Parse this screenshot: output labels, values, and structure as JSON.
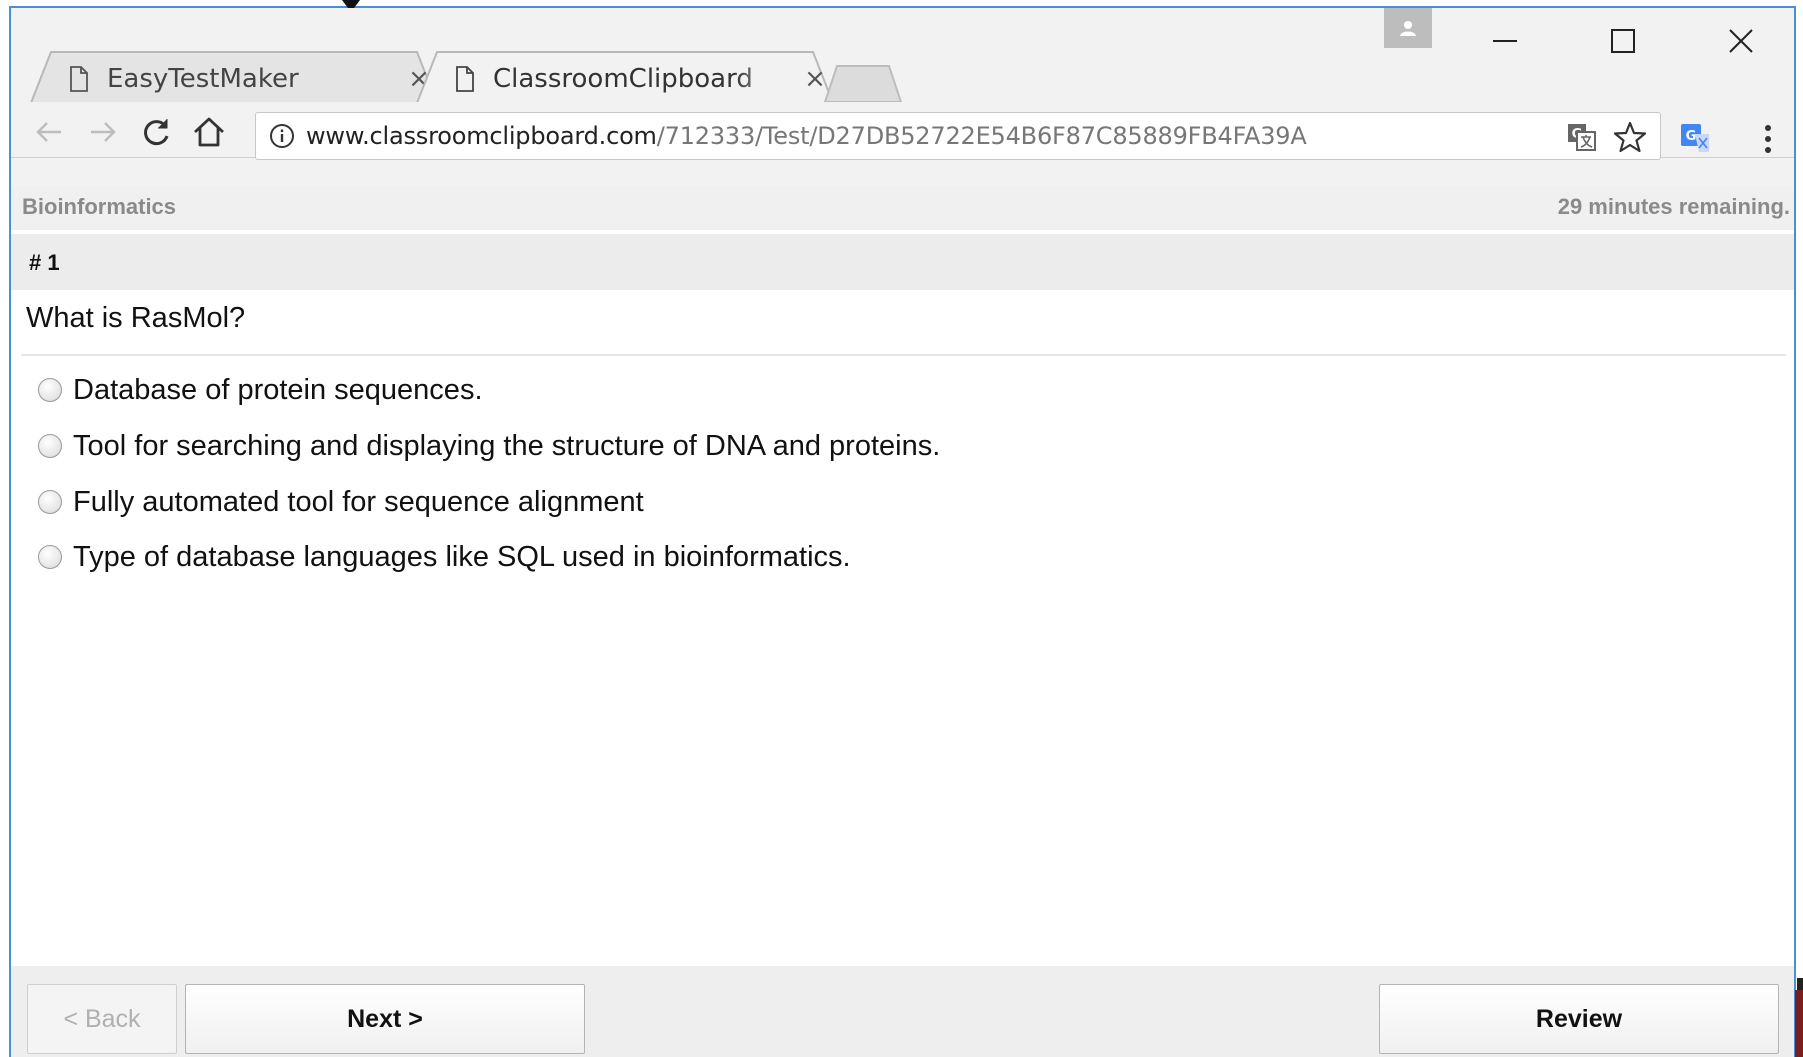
{
  "browser": {
    "tabs": [
      {
        "title": "EasyTestMaker",
        "close": "×",
        "active": false
      },
      {
        "title": "ClassroomClipboard",
        "close": "×",
        "active": true
      }
    ],
    "address": {
      "domain": "www.classroomclipboard.com",
      "path": "/712333/Test/D27DB52722E54B6F87C85889FB4FA39A"
    },
    "icons": {
      "back": "back-arrow-icon",
      "forward": "forward-arrow-icon",
      "reload": "reload-icon",
      "home": "home-icon",
      "info": "info-icon",
      "translate": "translate-icon",
      "bookmark": "star-icon",
      "menu": "kebab-menu-icon"
    }
  },
  "test": {
    "course": "Bioinformatics",
    "timer": "29 minutes remaining.",
    "question_number": "# 1",
    "question": "What is RasMol?",
    "answers": [
      "Database of protein sequences.",
      "Tool for searching and displaying the structure of DNA and proteins.",
      "Fully automated tool for sequence alignment",
      "Type of database languages like SQL used in bioinformatics."
    ],
    "buttons": {
      "back": "< Back",
      "next": "Next >",
      "review": "Review"
    }
  },
  "colors": {
    "window_border": "#4a90d9",
    "chrome_bg": "#f2f2f2",
    "header_text": "#8a8a8a"
  }
}
